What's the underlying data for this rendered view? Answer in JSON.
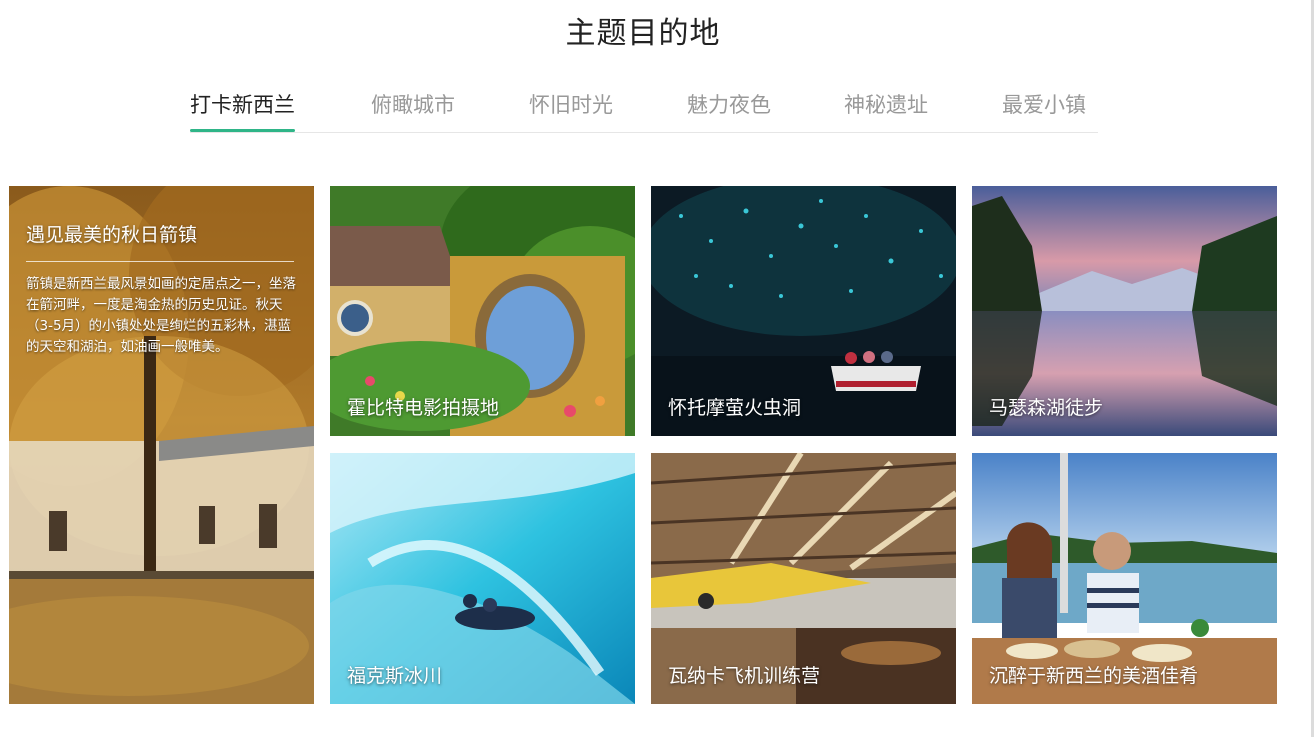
{
  "page": {
    "title": "主题目的地"
  },
  "tabs": [
    {
      "label": "打卡新西兰",
      "active": true
    },
    {
      "label": "俯瞰城市",
      "active": false
    },
    {
      "label": "怀旧时光",
      "active": false
    },
    {
      "label": "魅力夜色",
      "active": false
    },
    {
      "label": "神秘遗址",
      "active": false
    },
    {
      "label": "最爱小镇",
      "active": false
    }
  ],
  "feature": {
    "title": "遇见最美的秋日箭镇",
    "description": "箭镇是新西兰最风景如画的定居点之一，坐落在箭河畔，一度是淘金热的历史见证。秋天（3-5月）的小镇处处是绚烂的五彩林，湛蓝的天空和湖泊，如油画一般唯美。"
  },
  "cards": [
    {
      "caption": "霍比特电影拍摄地",
      "icon": "hobbit-house-photo"
    },
    {
      "caption": "怀托摩萤火虫洞",
      "icon": "glowworm-cave-photo"
    },
    {
      "caption": "马瑟森湖徒步",
      "icon": "lake-matheson-photo"
    },
    {
      "caption": "福克斯冰川",
      "icon": "fox-glacier-photo"
    },
    {
      "caption": "瓦纳卡飞机训练营",
      "icon": "wanaka-aircraft-photo"
    },
    {
      "caption": "沉醉于新西兰的美酒佳肴",
      "icon": "food-wine-photo"
    }
  ],
  "colors": {
    "accent": "#2fb588",
    "tab_active": "#222222",
    "tab_inactive": "#999999"
  }
}
